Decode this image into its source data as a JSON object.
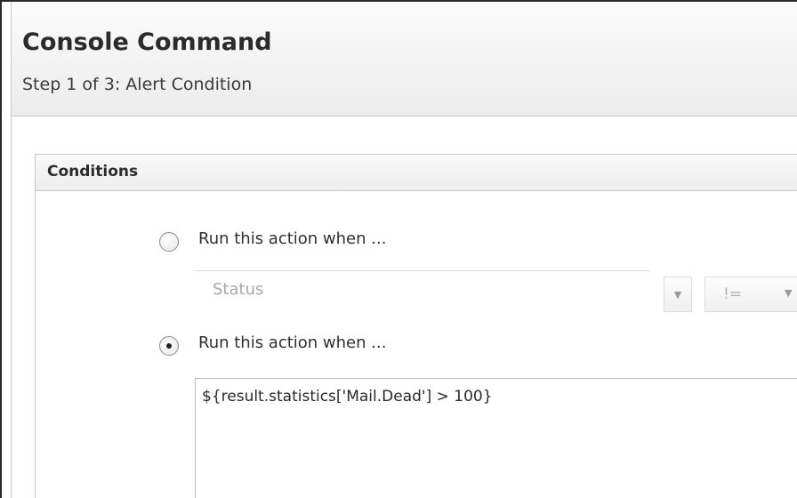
{
  "header": {
    "title": "Console Command",
    "subtitle": "Step 1 of 3: Alert Condition"
  },
  "conditions": {
    "panel_title": "Conditions",
    "option_status": {
      "label": "Run this action when ...",
      "selected": false,
      "field_value": "Status",
      "operator_value": "!="
    },
    "option_expression": {
      "label": "Run this action when ...",
      "selected": true,
      "expression": "${result.statistics['Mail.Dead'] > 100}"
    }
  },
  "icons": {
    "dropdown_arrow": "chevron-down-icon"
  }
}
